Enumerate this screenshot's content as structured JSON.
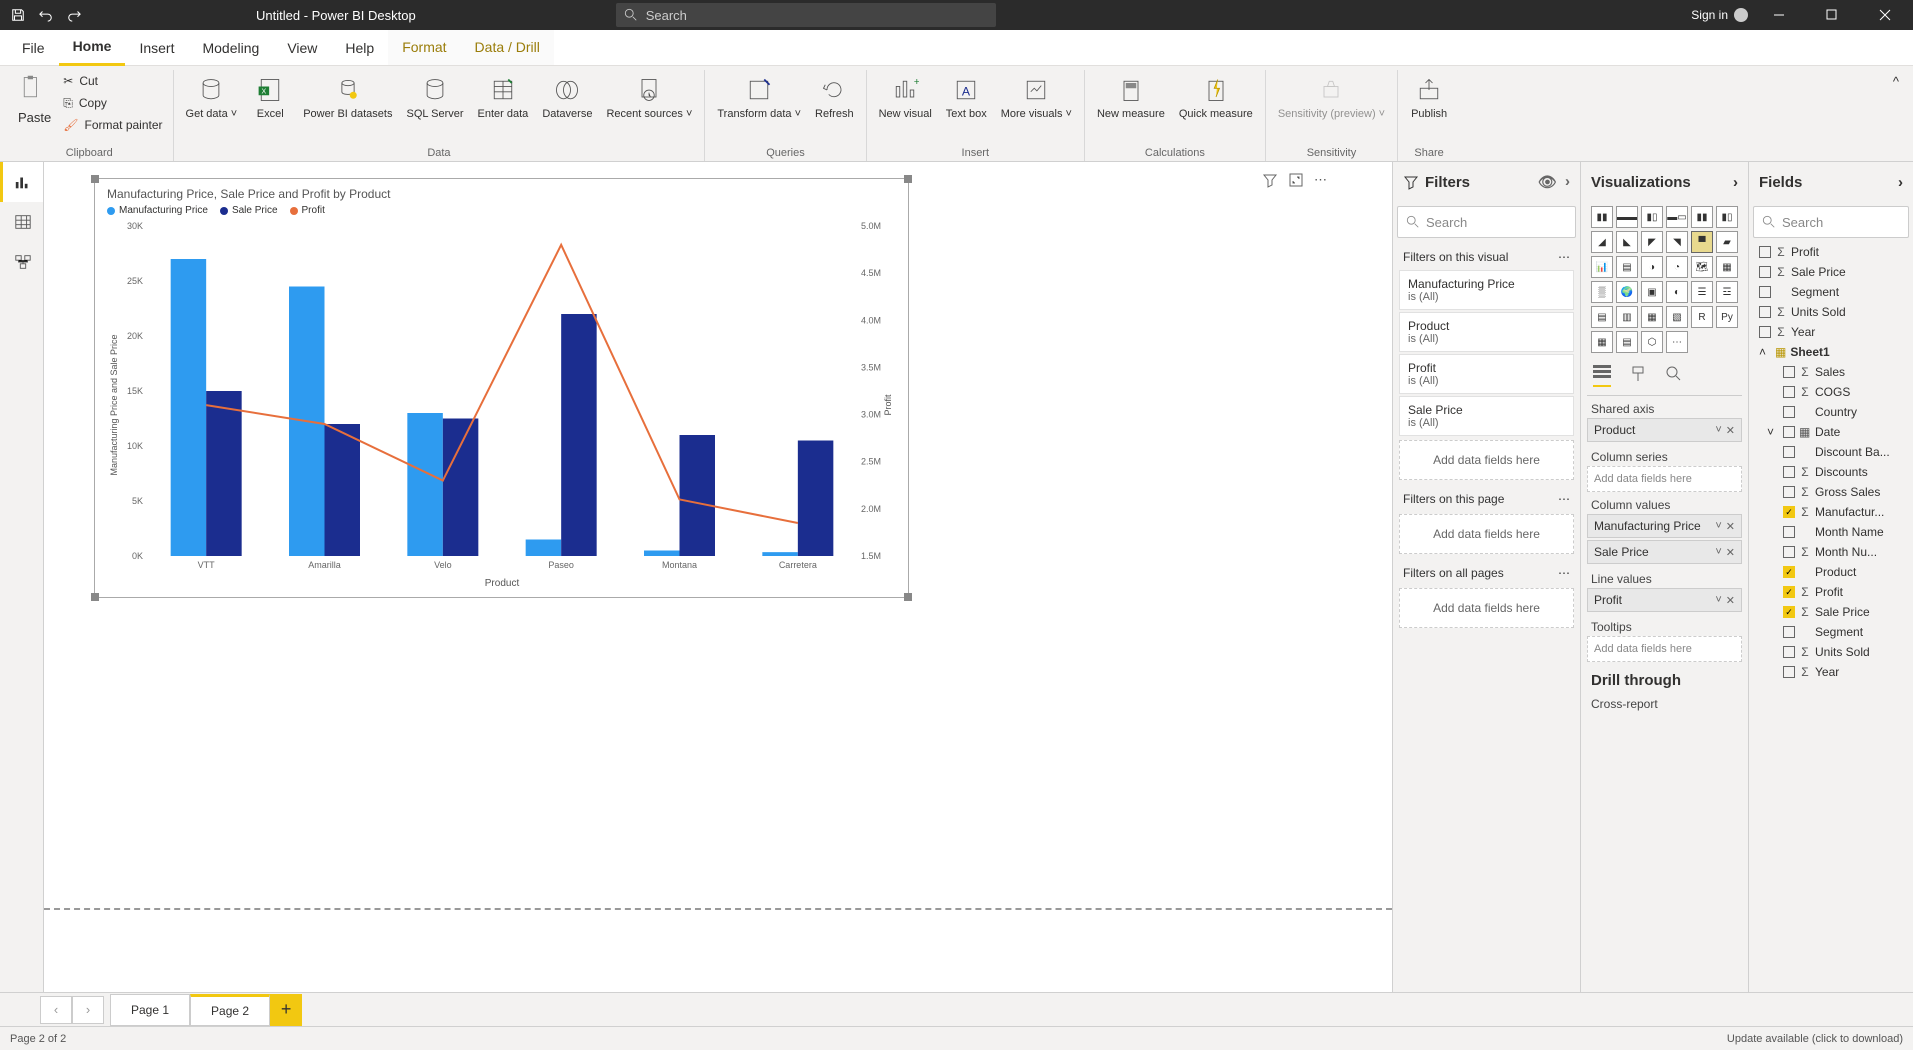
{
  "titlebar": {
    "title": "Untitled - Power BI Desktop",
    "search_placeholder": "Search",
    "signin": "Sign in"
  },
  "ribbon_tabs": {
    "file": "File",
    "home": "Home",
    "insert": "Insert",
    "modeling": "Modeling",
    "view": "View",
    "help": "Help",
    "format": "Format",
    "data_drill": "Data / Drill"
  },
  "ribbon": {
    "clipboard": {
      "label": "Clipboard",
      "paste": "Paste",
      "cut": "Cut",
      "copy": "Copy",
      "format_painter": "Format painter"
    },
    "data": {
      "label": "Data",
      "get_data": "Get\ndata",
      "excel": "Excel",
      "pbi_datasets": "Power BI\ndatasets",
      "sql_server": "SQL\nServer",
      "enter_data": "Enter\ndata",
      "dataverse": "Dataverse",
      "recent_sources": "Recent\nsources"
    },
    "queries": {
      "label": "Queries",
      "transform": "Transform\ndata",
      "refresh": "Refresh"
    },
    "insert": {
      "label": "Insert",
      "new_visual": "New\nvisual",
      "text_box": "Text\nbox",
      "more_visuals": "More\nvisuals"
    },
    "calculations": {
      "label": "Calculations",
      "new_measure": "New\nmeasure",
      "quick_measure": "Quick\nmeasure"
    },
    "sensitivity": {
      "label": "Sensitivity",
      "btn": "Sensitivity\n(preview)"
    },
    "share": {
      "label": "Share",
      "publish": "Publish"
    }
  },
  "filters": {
    "title": "Filters",
    "search_placeholder": "Search",
    "on_visual": "Filters on this visual",
    "on_page": "Filters on this page",
    "on_all": "Filters on all pages",
    "add": "Add data fields here",
    "cards": [
      {
        "name": "Manufacturing Price",
        "val": "is (All)"
      },
      {
        "name": "Product",
        "val": "is (All)"
      },
      {
        "name": "Profit",
        "val": "is (All)"
      },
      {
        "name": "Sale Price",
        "val": "is (All)"
      }
    ]
  },
  "viz": {
    "title": "Visualizations",
    "shared_axis": "Shared axis",
    "column_series": "Column series",
    "column_values": "Column values",
    "line_values": "Line values",
    "tooltips": "Tooltips",
    "drill_through": "Drill through",
    "cross_report": "Cross-report",
    "add": "Add data fields here",
    "wells": {
      "shared_axis": "Product",
      "col_val_1": "Manufacturing Price",
      "col_val_2": "Sale Price",
      "line_val": "Profit"
    }
  },
  "fields": {
    "title": "Fields",
    "search_placeholder": "Search",
    "root": [
      {
        "name": "Profit",
        "sigma": true,
        "checked": false
      },
      {
        "name": "Sale Price",
        "sigma": true,
        "checked": false
      },
      {
        "name": "Segment",
        "sigma": false,
        "checked": false
      },
      {
        "name": "Units Sold",
        "sigma": true,
        "checked": false
      },
      {
        "name": "Year",
        "sigma": true,
        "checked": false
      }
    ],
    "sheet": "Sheet1",
    "sheet_fields": [
      {
        "name": "Sales",
        "sigma": true,
        "checked": false
      },
      {
        "name": "COGS",
        "sigma": true,
        "checked": false
      },
      {
        "name": "Country",
        "sigma": false,
        "checked": false
      },
      {
        "name": "Date",
        "sigma": false,
        "checked": false,
        "table": true,
        "expand": true
      },
      {
        "name": "Discount Ba...",
        "sigma": false,
        "checked": false
      },
      {
        "name": "Discounts",
        "sigma": true,
        "checked": false
      },
      {
        "name": "Gross Sales",
        "sigma": true,
        "checked": false
      },
      {
        "name": "Manufactur...",
        "sigma": true,
        "checked": true
      },
      {
        "name": "Month Name",
        "sigma": false,
        "checked": false
      },
      {
        "name": "Month Nu...",
        "sigma": true,
        "checked": false
      },
      {
        "name": "Product",
        "sigma": false,
        "checked": true
      },
      {
        "name": "Profit",
        "sigma": true,
        "checked": true
      },
      {
        "name": "Sale Price",
        "sigma": true,
        "checked": true
      },
      {
        "name": "Segment",
        "sigma": false,
        "checked": false
      },
      {
        "name": "Units Sold",
        "sigma": true,
        "checked": false
      },
      {
        "name": "Year",
        "sigma": true,
        "checked": false
      }
    ]
  },
  "pages": {
    "page1": "Page 1",
    "page2": "Page 2"
  },
  "status": {
    "left": "Page 2 of 2",
    "right": "Update available (click to download)"
  },
  "chart_data": {
    "type": "bar",
    "title": "Manufacturing Price, Sale Price and Profit by Product",
    "xlabel": "Product",
    "ylabel_left": "Manufacturing Price and Sale Price",
    "ylabel_right": "Profit",
    "categories": [
      "VTT",
      "Amarilla",
      "Velo",
      "Paseo",
      "Montana",
      "Carretera"
    ],
    "series": [
      {
        "name": "Manufacturing Price",
        "color": "#2e9bf0",
        "values": [
          27000,
          24500,
          13000,
          1500,
          500,
          350
        ]
      },
      {
        "name": "Sale Price",
        "color": "#1b2d8f",
        "values": [
          15000,
          12000,
          12500,
          22000,
          11000,
          10500
        ]
      }
    ],
    "line": {
      "name": "Profit",
      "color": "#e76f3c",
      "values": [
        3100000,
        2900000,
        2300000,
        4800000,
        2100000,
        1850000
      ]
    },
    "ylim_left": [
      0,
      30000
    ],
    "ylim_right": [
      1500000,
      5000000
    ],
    "yticks_left": [
      "0K",
      "5K",
      "10K",
      "15K",
      "20K",
      "25K",
      "30K"
    ],
    "yticks_right": [
      "1.5M",
      "2.0M",
      "2.5M",
      "3.0M",
      "3.5M",
      "4.0M",
      "4.5M",
      "5.0M"
    ]
  }
}
